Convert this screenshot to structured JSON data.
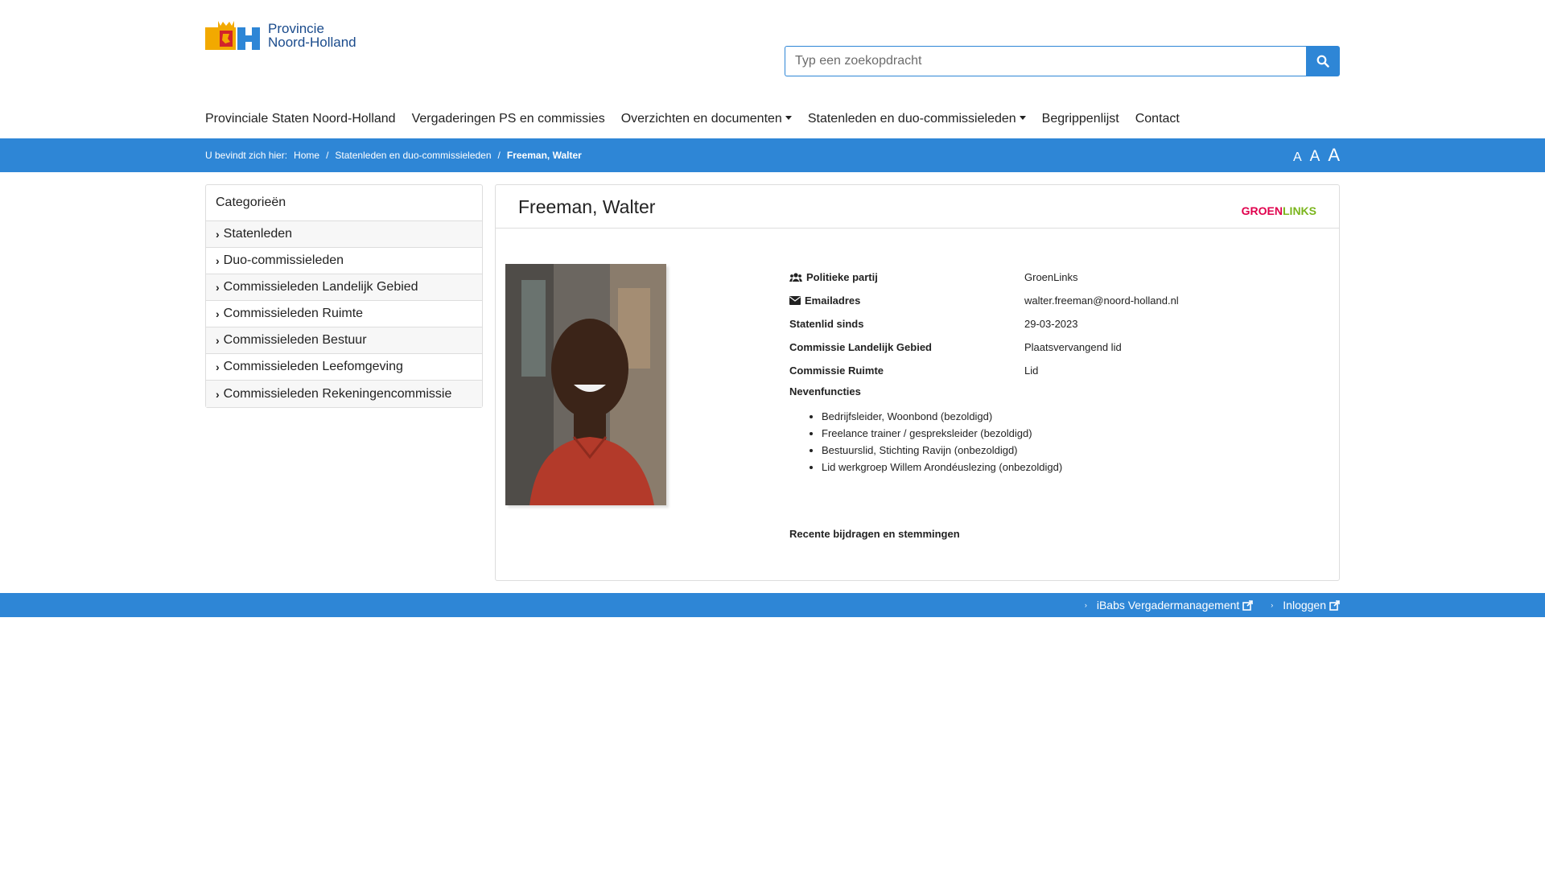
{
  "brand": {
    "line1": "Provincie",
    "line2": "Noord-Holland"
  },
  "search": {
    "placeholder": "Typ een zoekopdracht"
  },
  "nav": [
    {
      "label": "Provinciale Staten Noord-Holland"
    },
    {
      "label": "Vergaderingen PS en commissies"
    },
    {
      "label": "Overzichten en documenten"
    },
    {
      "label": "Statenleden en duo-commissieleden"
    },
    {
      "label": "Begrippenlijst"
    },
    {
      "label": "Contact"
    }
  ],
  "breadcrumb": {
    "prefix": "U bevindt zich hier:",
    "home": "Home",
    "sep": "/",
    "section": "Statenleden en duo-commissieleden",
    "current": "Freeman, Walter"
  },
  "fontsize": {
    "small": "A",
    "medium": "A",
    "large": "A"
  },
  "sidebar": {
    "title": "Categorieën",
    "items": [
      {
        "label": "Statenleden"
      },
      {
        "label": "Duo-commissieleden"
      },
      {
        "label": "Commissieleden Landelijk Gebied"
      },
      {
        "label": "Commissieleden Ruimte"
      },
      {
        "label": "Commissieleden Bestuur"
      },
      {
        "label": "Commissieleden Leefomgeving"
      },
      {
        "label": "Commissieleden Rekeningencommissie"
      }
    ]
  },
  "profile": {
    "name": "Freeman, Walter",
    "party_logo": {
      "part1": "GROEN",
      "part2": "LINKS"
    },
    "fields": [
      {
        "key": "Politieke partij",
        "value": "GroenLinks",
        "icon": "users-icon"
      },
      {
        "key": "Emailadres",
        "value": "walter.freeman@noord-holland.nl",
        "icon": "envelope-icon"
      },
      {
        "key": "Statenlid sinds",
        "value": "29-03-2023"
      },
      {
        "key": "Commissie Landelijk Gebied",
        "value": "Plaatsvervangend lid"
      },
      {
        "key": "Commissie Ruimte",
        "value": "Lid"
      }
    ],
    "nevenfuncties_label": "Nevenfuncties",
    "nevenfuncties": [
      "Bedrijfsleider, Woonbond (bezoldigd)",
      "Freelance trainer / gespreksleider (bezoldigd)",
      "Bestuurslid, Stichting Ravijn (onbezoldigd)",
      "Lid werkgroep Willem Arondéuslezing (onbezoldigd)"
    ],
    "recent_label": "Recente bijdragen en stemmingen"
  },
  "footer": {
    "links": [
      {
        "label": "iBabs Vergadermanagement"
      },
      {
        "label": "Inloggen"
      }
    ]
  },
  "colors": {
    "accent": "#2e86d6",
    "brand_blue": "#1a4b8c",
    "party_red": "#e0004d",
    "party_green": "#7bb51d"
  }
}
